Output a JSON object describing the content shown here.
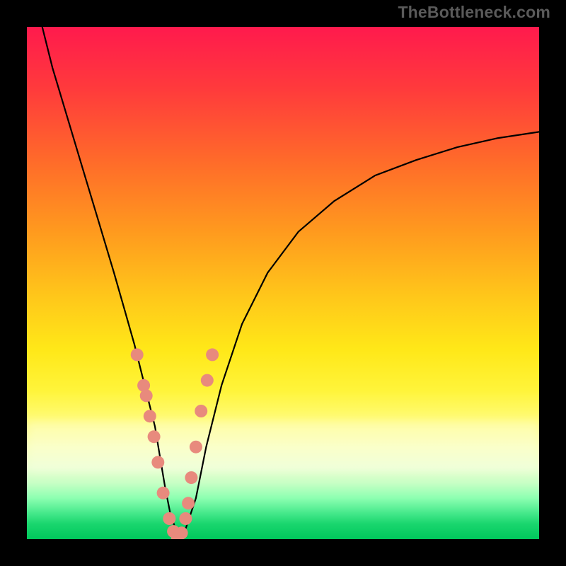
{
  "watermark": "TheBottleneck.com",
  "colors": {
    "frame": "#000000",
    "curve": "#000000",
    "marker": "#e88a7d"
  },
  "chart_data": {
    "type": "line",
    "title": "",
    "xlabel": "",
    "ylabel": "",
    "xlim": [
      0,
      100
    ],
    "ylim": [
      0,
      100
    ],
    "grid": false,
    "legend": false,
    "note": "Bottleneck-style V curve; x is relative component scale (0-100), y is bottleneck % (0 = balanced at valley).",
    "series": [
      {
        "name": "bottleneck_curve",
        "x": [
          3,
          5,
          8,
          11,
          14,
          17,
          19,
          21,
          23,
          25,
          26,
          27,
          28,
          29,
          30,
          31,
          33,
          35,
          38,
          42,
          47,
          53,
          60,
          68,
          76,
          84,
          92,
          100
        ],
        "y": [
          100,
          92,
          82,
          72,
          62,
          52,
          45,
          38,
          30,
          22,
          16,
          10,
          5,
          2,
          0,
          2,
          8,
          18,
          30,
          42,
          52,
          60,
          66,
          71,
          74,
          76.5,
          78.3,
          79.5
        ]
      }
    ],
    "markers": {
      "name": "highlight_points",
      "x": [
        21.5,
        22.8,
        23.3,
        24.0,
        24.8,
        25.6,
        26.6,
        27.8,
        28.6,
        29.4,
        30.2,
        31.0,
        31.5,
        32.1,
        33.0,
        34.0,
        35.2,
        36.2
      ],
      "y": [
        36,
        30,
        28,
        24,
        20,
        15,
        9,
        4,
        1.5,
        0.3,
        1.2,
        4,
        7,
        12,
        18,
        25,
        31,
        36
      ]
    },
    "valley_x": 29.5
  }
}
